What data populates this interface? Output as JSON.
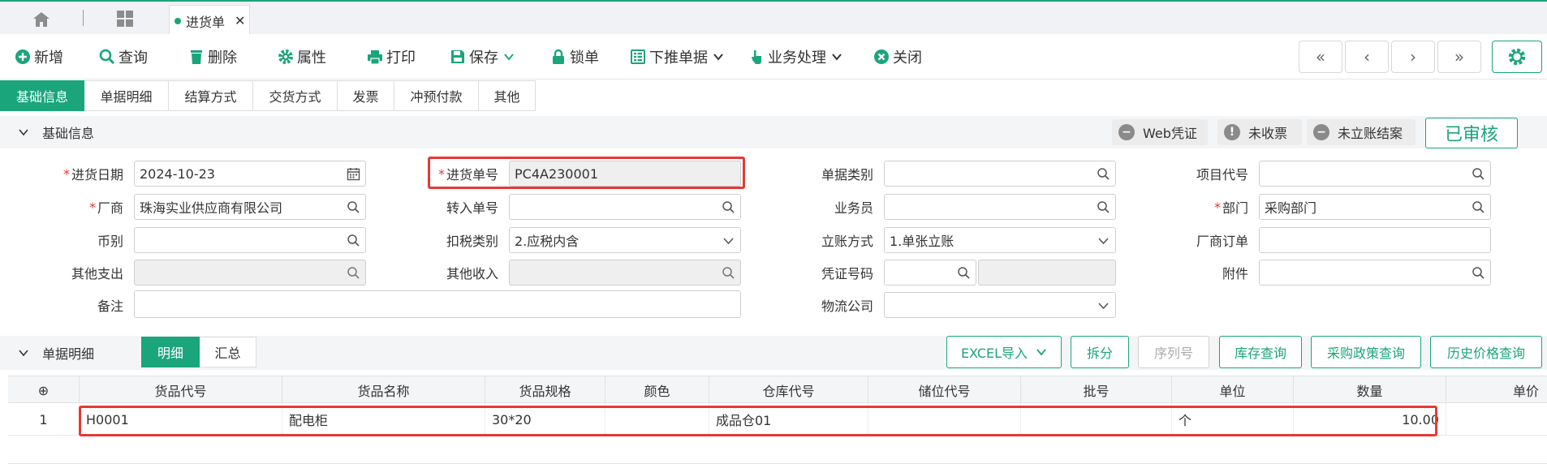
{
  "tabs": {
    "doc_tab": "进货单",
    "close": "✕"
  },
  "toolbar": {
    "add": "新增",
    "query": "查询",
    "delete": "删除",
    "properties": "属性",
    "print": "打印",
    "save": "保存",
    "lock": "锁单",
    "push_down": "下推单据",
    "business": "业务处理",
    "close": "关闭"
  },
  "nav": {
    "first": "«",
    "prev": "‹",
    "next": "›",
    "last": "»"
  },
  "subtabs": [
    "基础信息",
    "单据明细",
    "结算方式",
    "交货方式",
    "发票",
    "冲预付款",
    "其他"
  ],
  "basic_section": {
    "title": "基础信息",
    "web_voucher": "Web凭证",
    "unreceived": "未收票",
    "unsettled": "未立账结案",
    "status": "已审核"
  },
  "form": {
    "purchase_date": {
      "label": "进货日期",
      "value": "2024-10-23"
    },
    "purchase_no": {
      "label": "进货单号",
      "value": "PC4A230001"
    },
    "doc_type": {
      "label": "单据类别",
      "value": ""
    },
    "project_code": {
      "label": "项目代号",
      "value": ""
    },
    "vendor": {
      "label": "厂商",
      "value": "珠海实业供应商有限公司"
    },
    "transfer_no": {
      "label": "转入单号",
      "value": ""
    },
    "salesperson": {
      "label": "业务员",
      "value": ""
    },
    "department": {
      "label": "部门",
      "value": "采购部门"
    },
    "currency": {
      "label": "币别",
      "value": ""
    },
    "tax_type": {
      "label": "扣税类别",
      "value": "2.应税内含"
    },
    "account_method": {
      "label": "立账方式",
      "value": "1.单张立账"
    },
    "vendor_order": {
      "label": "厂商订单",
      "value": ""
    },
    "other_expense": {
      "label": "其他支出",
      "value": ""
    },
    "other_income": {
      "label": "其他收入",
      "value": ""
    },
    "voucher_no": {
      "label": "凭证号码",
      "value": ""
    },
    "attachment": {
      "label": "附件",
      "value": ""
    },
    "remark": {
      "label": "备注",
      "value": ""
    },
    "logistics": {
      "label": "物流公司",
      "value": ""
    }
  },
  "detail_section": {
    "title": "单据明细",
    "detail": "明细",
    "summary": "汇总",
    "excel_import": "EXCEL导入",
    "split": "拆分",
    "serial": "序列号",
    "stock_query": "库存查询",
    "policy_query": "采购政策查询",
    "price_history": "历史价格查询"
  },
  "table": {
    "add_icon": "⊕",
    "headers": [
      "货品代号",
      "货品名称",
      "货品规格",
      "颜色",
      "仓库代号",
      "储位代号",
      "批号",
      "单位",
      "数量",
      "单价"
    ],
    "rows": [
      {
        "no": "1",
        "code": "H0001",
        "name": "配电柜",
        "spec": "30*20",
        "color": "",
        "warehouse": "成品仓01",
        "location": "",
        "batch": "",
        "unit": "个",
        "qty": "10.00",
        "price": ""
      }
    ]
  },
  "colors": {
    "accent": "#1aa57a",
    "highlight": "#e53935"
  }
}
